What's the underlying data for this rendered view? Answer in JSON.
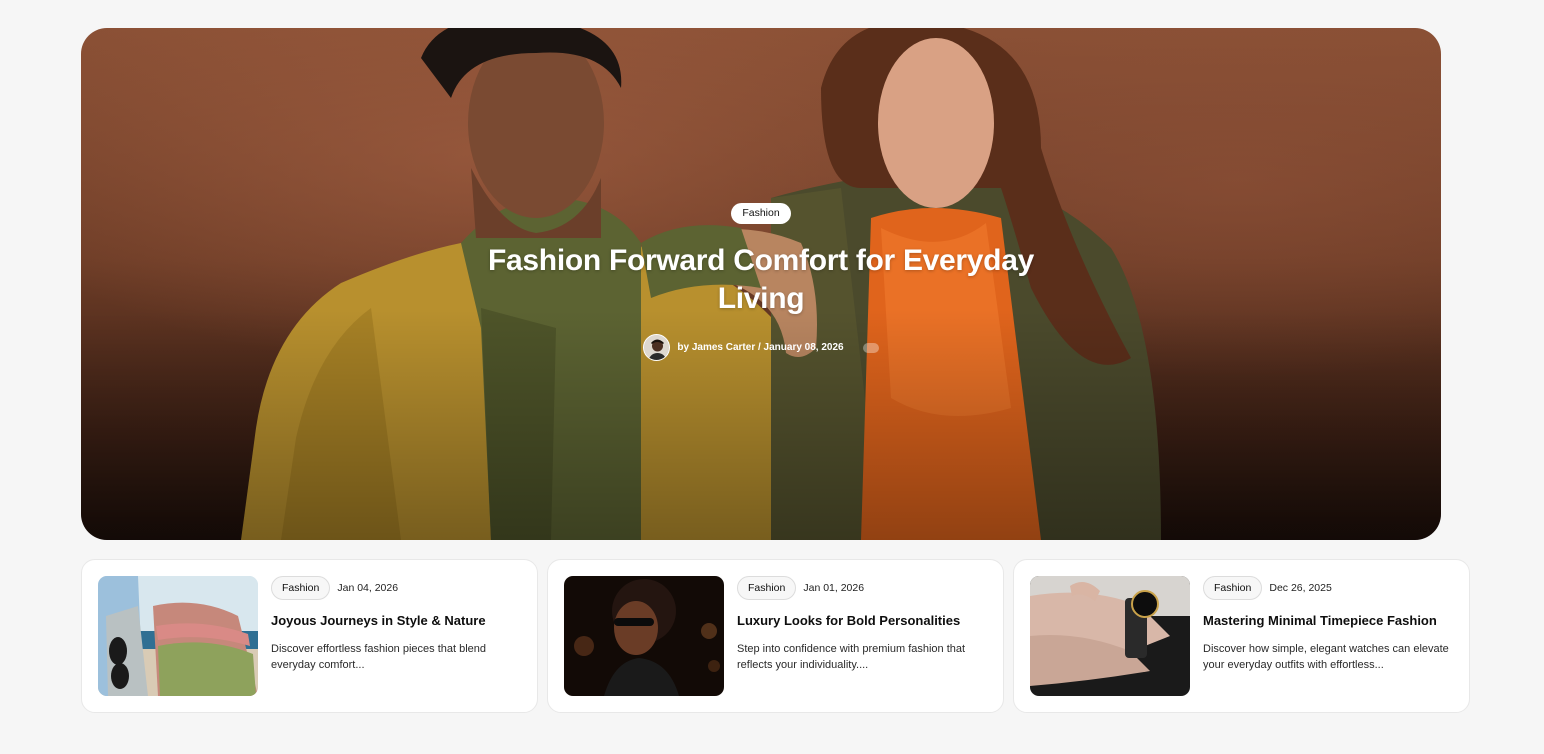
{
  "hero": {
    "category": "Fashion",
    "title": "Fashion Forward Comfort for Everyday Living",
    "byline": "by James Carter / January 08, 2026"
  },
  "cards": [
    {
      "category": "Fashion",
      "date": "Jan 04, 2026",
      "title": "Joyous Journeys in Style & Nature",
      "excerpt": "Discover effortless fashion pieces that blend everyday comfort..."
    },
    {
      "category": "Fashion",
      "date": "Jan 01, 2026",
      "title": "Luxury Looks for Bold Personalities",
      "excerpt": "Step into confidence with premium fashion that reflects your individuality...."
    },
    {
      "category": "Fashion",
      "date": "Dec 26, 2025",
      "title": "Mastering Minimal Timepiece Fashion",
      "excerpt": "Discover how simple, elegant watches can elevate your everyday outfits with effortless..."
    }
  ]
}
